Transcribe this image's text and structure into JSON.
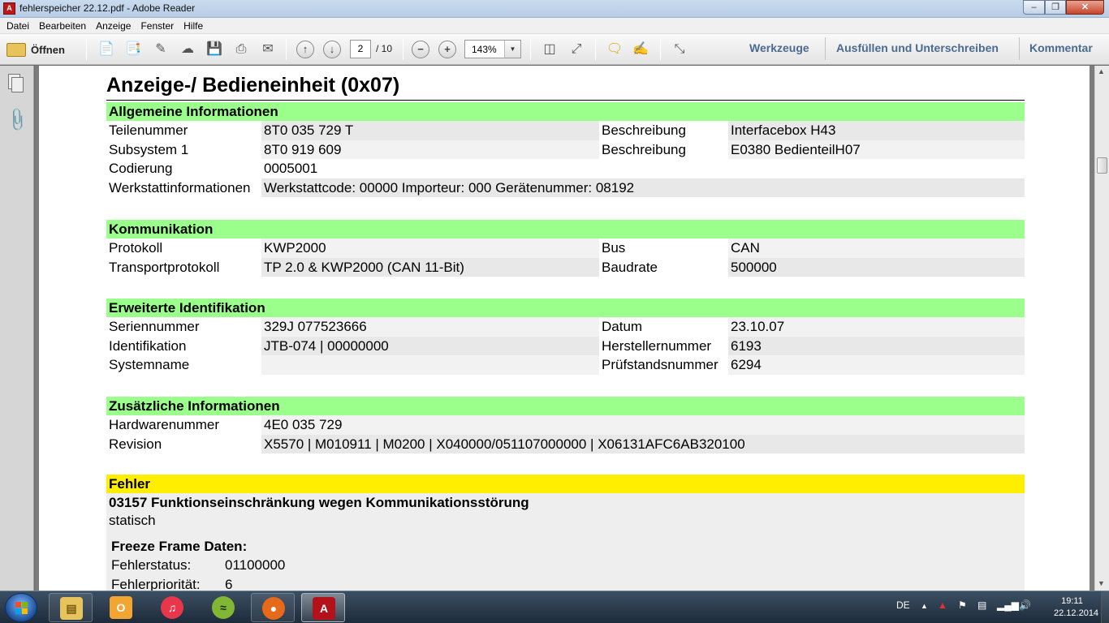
{
  "window": {
    "title": "fehlerspeicher 22.12.pdf - Adobe Reader",
    "icon": "adobe-reader-icon"
  },
  "menu": [
    "Datei",
    "Bearbeiten",
    "Anzeige",
    "Fenster",
    "Hilfe"
  ],
  "toolbar": {
    "open_label": "Öffnen",
    "page_current": "2",
    "page_total": "/ 10",
    "zoom": "143%",
    "panels": [
      "Werkzeuge",
      "Ausfüllen und Unterschreiben",
      "Kommentar"
    ]
  },
  "document": {
    "title": "Anzeige-/ Bedieneinheit (0x07)",
    "sections": {
      "allgemein": {
        "heading": "Allgemeine Informationen",
        "rows": [
          [
            "Teilenummer",
            "8T0 035 729 T",
            "Beschreibung",
            "Interfacebox  H43"
          ],
          [
            "Subsystem 1",
            "8T0 919 609",
            "Beschreibung",
            "E0380 BedienteilH07"
          ],
          [
            "Codierung",
            "0005001",
            "",
            ""
          ]
        ],
        "werkstatt_label": "Werkstattinformationen",
        "werkstatt_value": "Werkstattcode: 00000  Importeur: 000  Gerätenummer: 08192"
      },
      "kommunikation": {
        "heading": "Kommunikation",
        "rows": [
          [
            "Protokoll",
            "KWP2000",
            "Bus",
            "CAN"
          ],
          [
            "Transportprotokoll",
            "TP 2.0 & KWP2000 (CAN 11-Bit)",
            "Baudrate",
            "500000"
          ]
        ]
      },
      "erweitert": {
        "heading": "Erweiterte Identifikation",
        "rows": [
          [
            "Seriennummer",
            "329J 077523666",
            "Datum",
            "23.10.07"
          ],
          [
            "Identifikation",
            "JTB-074 | 00000000",
            "Herstellernummer",
            "6193"
          ],
          [
            "Systemname",
            "",
            "Prüfstandsnummer",
            "6294"
          ]
        ]
      },
      "zusatz": {
        "heading": "Zusätzliche Informationen",
        "rows": [
          [
            "Hardwarenummer",
            "4E0 035 729"
          ],
          [
            "Revision",
            "X5570 | M010911 | M0200 | X040000/051107000000 | X06131AFC6AB320100"
          ]
        ]
      },
      "fehler": {
        "heading": "Fehler",
        "code": "03157 Funktionseinschränkung wegen Kommunikationsstörung",
        "type": "statisch",
        "freeze_title": "Freeze Frame Daten:",
        "freeze": [
          [
            "Fehlerstatus:",
            "01100000"
          ],
          [
            "Fehlerpriorität:",
            "6"
          ]
        ]
      }
    }
  },
  "taskbar": {
    "language": "DE",
    "time": "19:11",
    "date": "22.12.2014"
  }
}
